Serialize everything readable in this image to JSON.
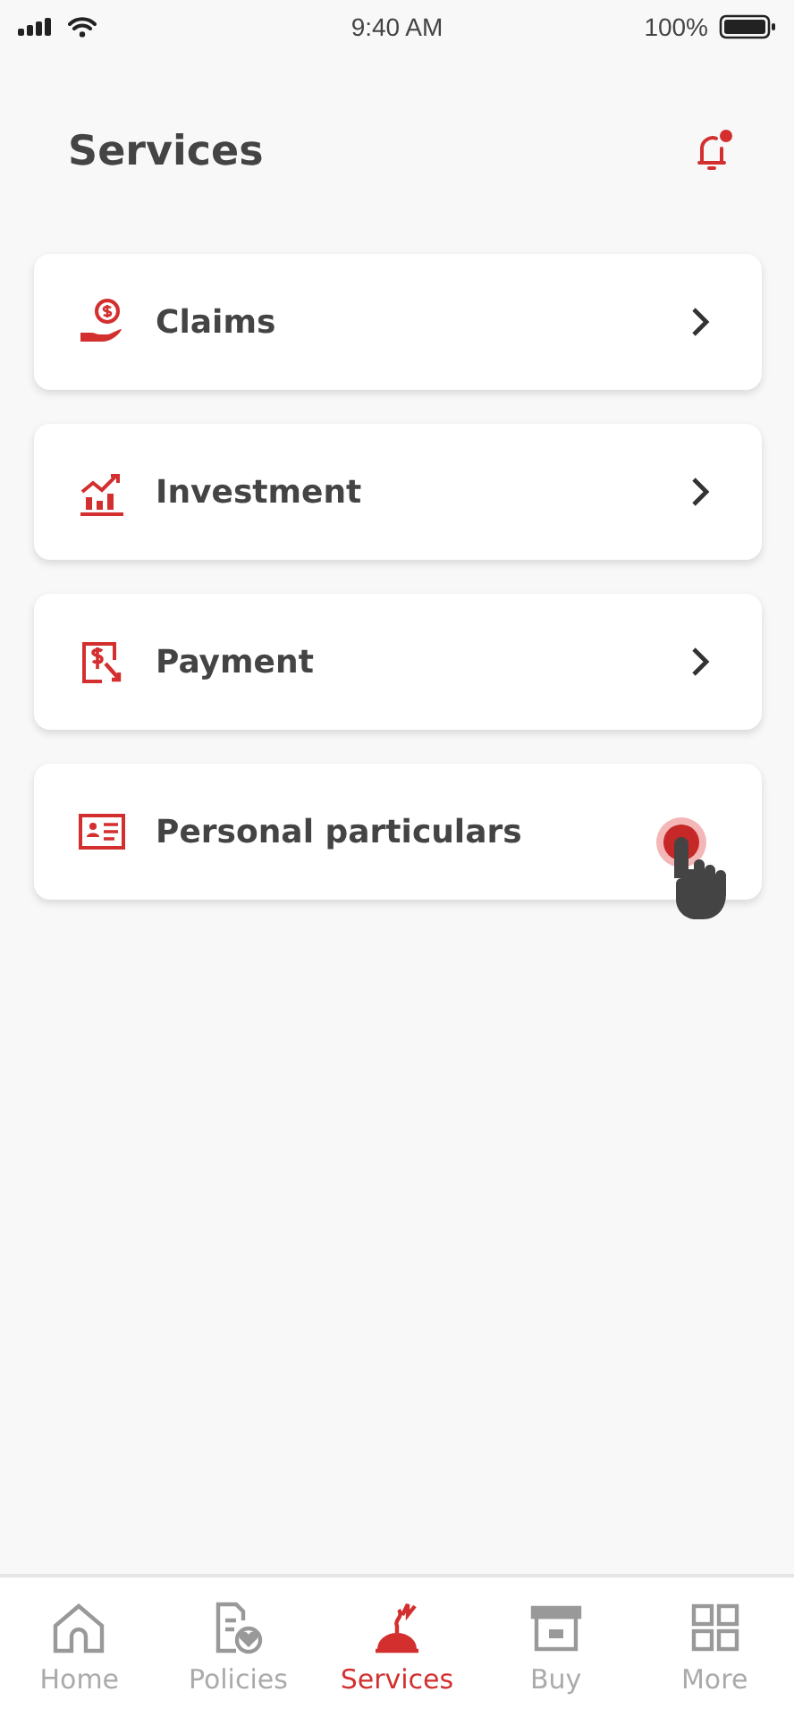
{
  "status_bar": {
    "time": "9:40 AM",
    "battery": "100%"
  },
  "header": {
    "title": "Services",
    "notification_unread": true
  },
  "services": [
    {
      "kind": "claims",
      "label": "Claims",
      "tapped": false
    },
    {
      "kind": "investment",
      "label": "Investment",
      "tapped": false
    },
    {
      "kind": "payment",
      "label": "Payment",
      "tapped": false
    },
    {
      "kind": "particulars",
      "label": "Personal particulars",
      "tapped": true
    }
  ],
  "bottom_nav": [
    {
      "kind": "home",
      "label": "Home",
      "selected": false
    },
    {
      "kind": "policies",
      "label": "Policies",
      "selected": false
    },
    {
      "kind": "services",
      "label": "Services",
      "selected": true
    },
    {
      "kind": "buy",
      "label": "Buy",
      "selected": false
    },
    {
      "kind": "more",
      "label": "More",
      "selected": false
    }
  ]
}
